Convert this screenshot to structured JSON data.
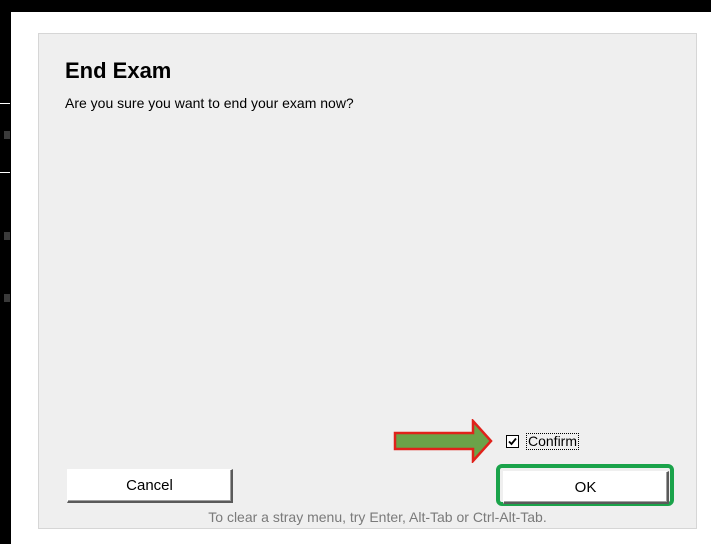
{
  "dialog": {
    "title": "End Exam",
    "message": "Are you sure you want to end your exam now?",
    "confirm": {
      "label": "Confirm",
      "checked": true
    },
    "buttons": {
      "cancel": "Cancel",
      "ok": "OK"
    },
    "hint": "To clear a stray menu, try Enter, Alt-Tab or Ctrl-Alt-Tab."
  },
  "annotations": {
    "arrow_fill": "#6ba349",
    "arrow_outline": "#e0221b",
    "ok_highlight_color": "#1aa34a"
  },
  "icons": {
    "checkbox_mark": "check-icon",
    "pointer": "arrow-right-icon"
  }
}
